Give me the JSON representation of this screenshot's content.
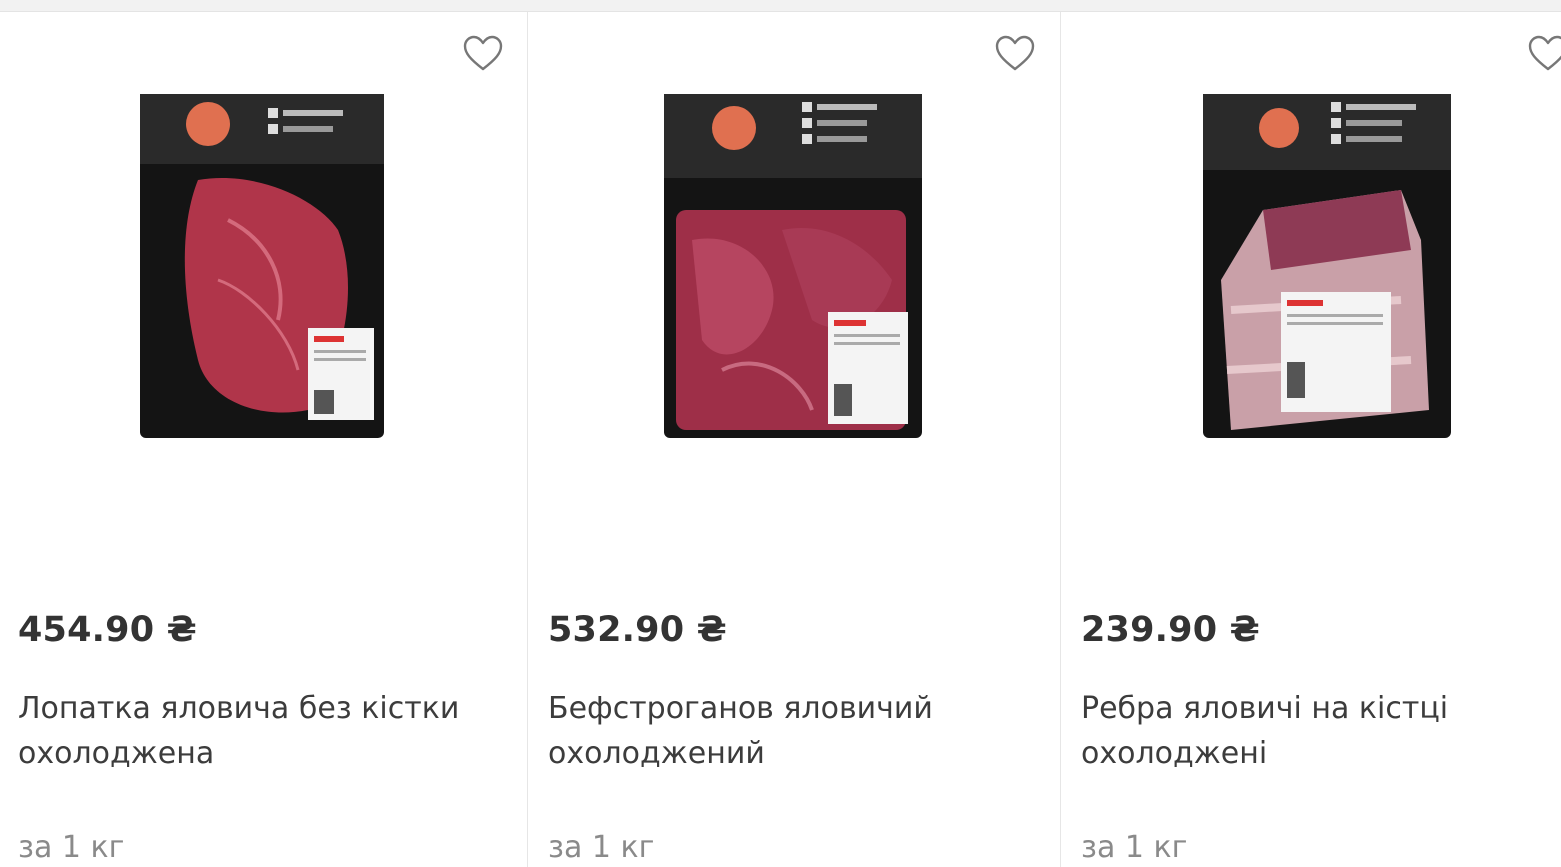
{
  "products": [
    {
      "price": "454.90 ₴",
      "title": "Лопатка яловича без кістки охолоджена",
      "unit": "за 1 кг",
      "favorite_icon": "heart-outline-icon",
      "image": "beef-shoulder-vacuum-pack"
    },
    {
      "price": "532.90 ₴",
      "title": "Бефстроганов яловичий охолоджений",
      "unit": "за 1 кг",
      "favorite_icon": "heart-outline-icon",
      "image": "beef-stroganoff-vacuum-pack"
    },
    {
      "price": "239.90 ₴",
      "title": "Ребра яловичі на кістці охолоджені",
      "unit": "за 1 кг",
      "favorite_icon": "heart-outline-icon",
      "image": "beef-ribs-vacuum-pack"
    }
  ],
  "colors": {
    "text": "#333333",
    "muted": "#8a8a8a",
    "divider": "#e6e6e6",
    "icon": "#777777"
  }
}
